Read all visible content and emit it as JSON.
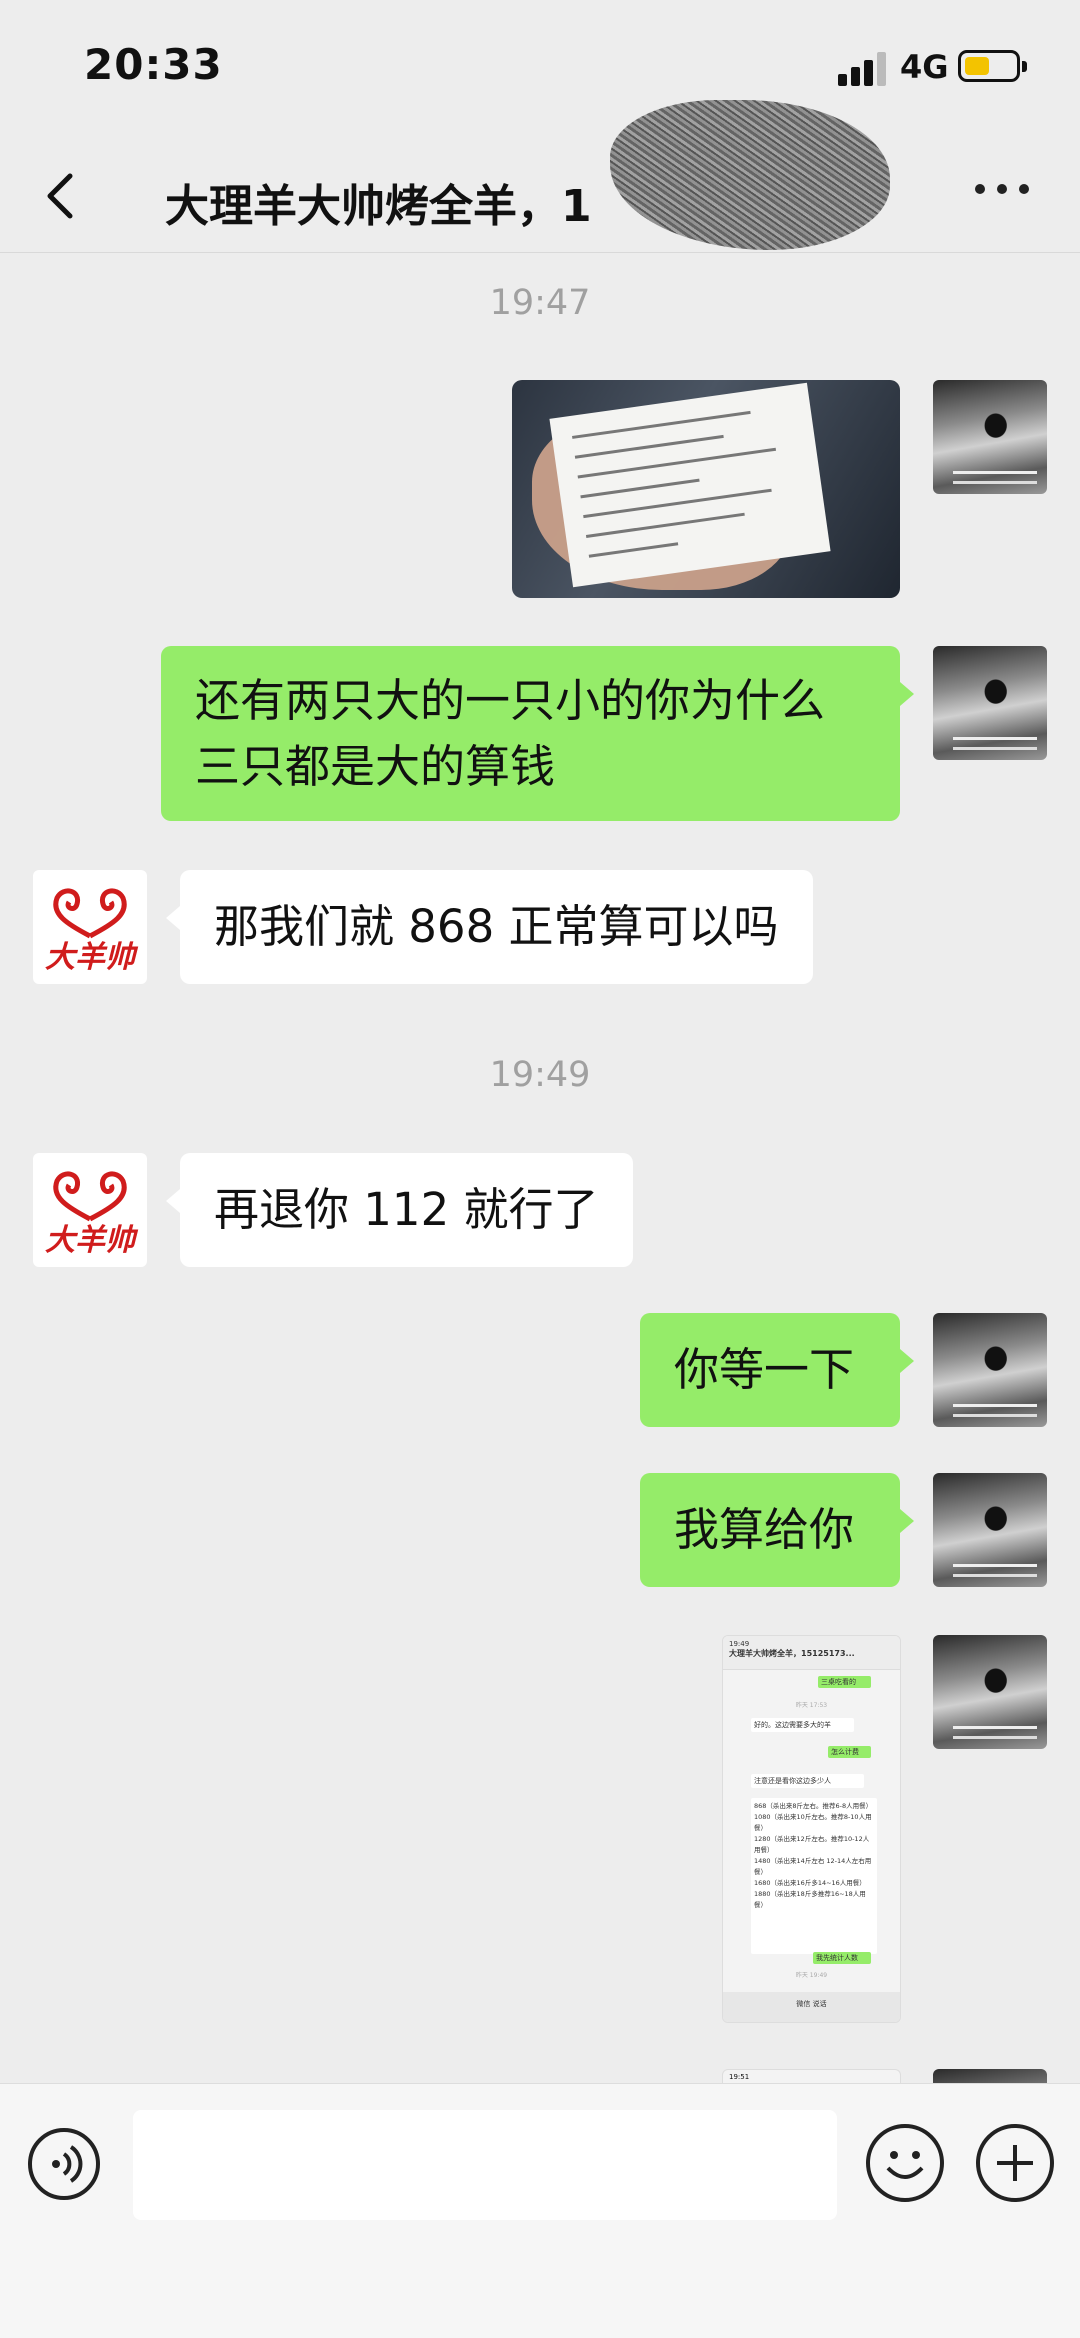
{
  "status_bar": {
    "time": "20:33",
    "network": "4G"
  },
  "header": {
    "title": "大理羊大帅烤全羊，1",
    "more_icon": "more-dots-icon",
    "back_icon": "back-chevron-icon"
  },
  "messages": {
    "ts1": "19:47",
    "m2": "还有两只大的一只小的你为什么三只都是大的算钱",
    "m3": "那我们就 868 正常算可以吗",
    "ts2": "19:49",
    "m4": "再退你 112 就行了",
    "m5": "你等一下",
    "m6": "我算给你"
  },
  "other_avatar": {
    "logo_text": "大羊帅",
    "color": "#d01c1c"
  },
  "screenshot_thumb": {
    "time": "19:49",
    "title": "大理羊大帅烤全羊，15125173...",
    "b1": "三桌吃看的",
    "ts": "昨天 17:53",
    "b2": "好的。这边需要多大的羊",
    "b3": "怎么计费",
    "b4": "注意还是看你这边多少人",
    "prices": [
      "868（杀出来8斤左右。推荐6-8人用餐）",
      "1080（杀出来10斤左右。推荐8-10人用餐）",
      "1280（杀出来12斤左右。推荐10-12人用餐）",
      "1480（杀出来14斤左右 12-14人左右用餐）",
      "1680（杀出来16斤多14~16人用餐）",
      "1880（杀出来18斤多推荐16~18人用餐）"
    ],
    "b5": "我先统计人数",
    "ts2": "昨天 19:49",
    "bottom": "微信 说话"
  },
  "screenshot_thumb2": {
    "time": "19:51"
  },
  "colors": {
    "sent_bubble": "#95ec69",
    "received_bubble": "#ffffff",
    "background": "#ededed"
  }
}
